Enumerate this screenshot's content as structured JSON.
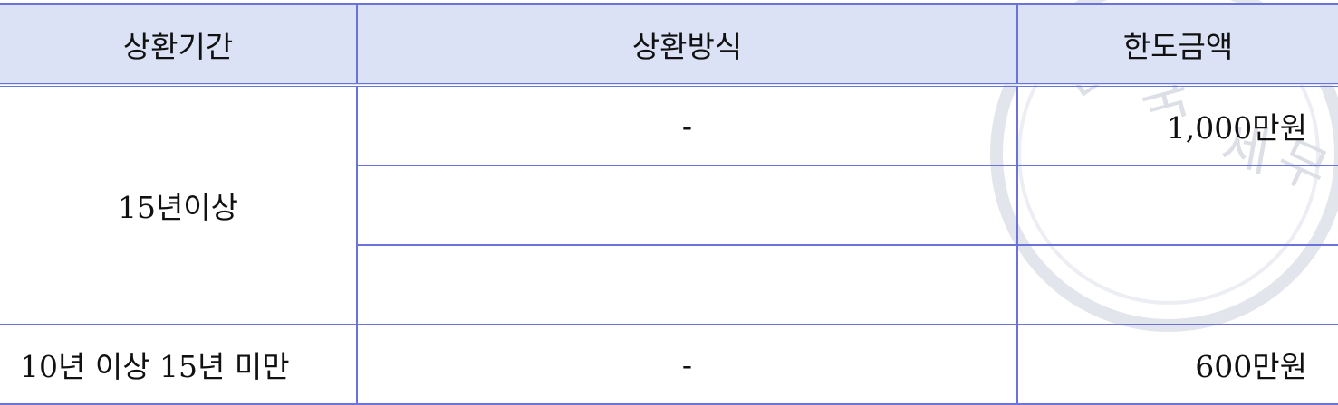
{
  "table": {
    "headers": {
      "period": "상환기간",
      "method": "상환방식",
      "limit": "한도금액"
    },
    "rows": [
      {
        "period": "15년이상",
        "method": "-",
        "limit": "1,000만원"
      },
      {
        "period": "",
        "method": "",
        "limit": ""
      },
      {
        "period": "",
        "method": "",
        "limit": ""
      },
      {
        "period": "10년 이상 15년 미만",
        "method": "-",
        "limit": "600만원"
      }
    ]
  },
  "watermark": {
    "text": "한국세무",
    "color": "#d9dbe4"
  },
  "colors": {
    "border": "#6a73d9",
    "header_bg": "#dbe2f5"
  }
}
